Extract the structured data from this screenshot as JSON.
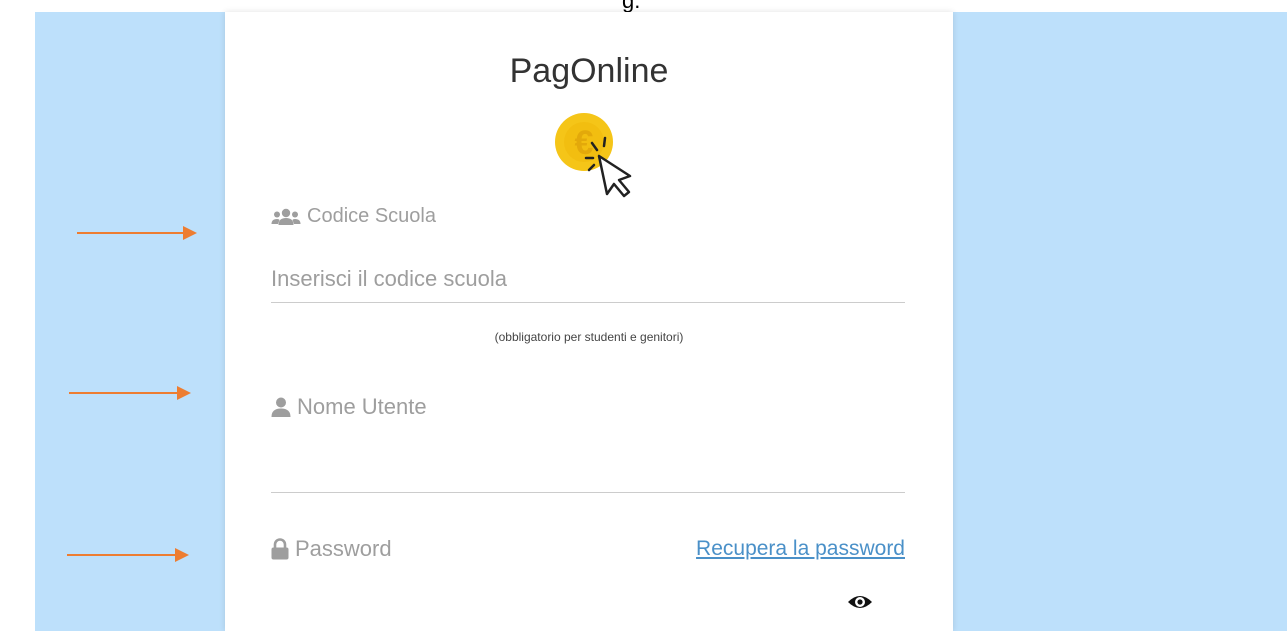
{
  "top_fragment": "g.",
  "app": {
    "title": "PagOnline",
    "logo": {
      "icon": "euro-coin-cursor-icon"
    }
  },
  "form": {
    "school_code": {
      "icon": "users-icon",
      "label": "Codice Scuola",
      "placeholder": "Inserisci il codice scuola",
      "value": "",
      "hint": "(obbligatorio per studenti e genitori)"
    },
    "username": {
      "icon": "user-icon",
      "label": "Nome Utente",
      "placeholder": "",
      "value": ""
    },
    "password": {
      "icon": "lock-icon",
      "label": "Password",
      "recover_link": "Recupera la password",
      "toggle_icon": "eye-icon"
    }
  },
  "colors": {
    "side_background": "#bde0fb",
    "arrow": "#ed7d31",
    "link": "#4a90c8",
    "coin": "#f5c518"
  }
}
